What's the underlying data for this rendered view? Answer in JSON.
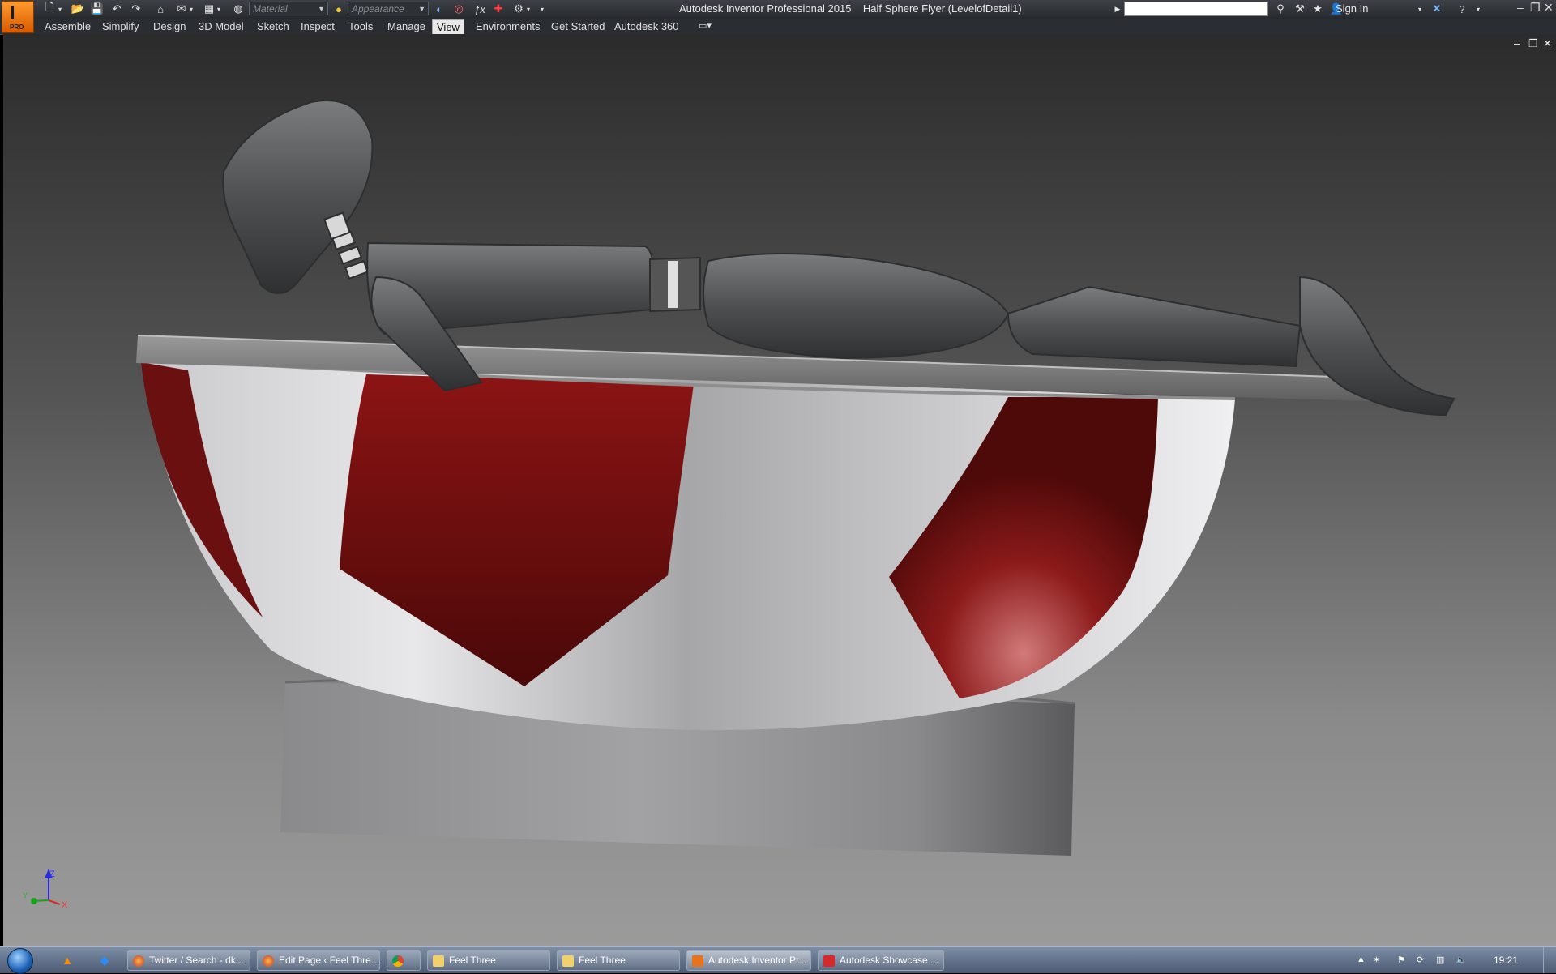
{
  "app": {
    "title": "Autodesk Inventor Professional 2015",
    "document": "Half Sphere Flyer (LevelofDetail1)",
    "logo_letter": "I",
    "logo_badge": "PRO"
  },
  "quick_access": {
    "material_placeholder": "Material",
    "appearance_placeholder": "Appearance"
  },
  "header_right": {
    "sign_in": "Sign In"
  },
  "menu": [
    "Assemble",
    "Simplify",
    "Design",
    "3D Model",
    "Sketch",
    "Inspect",
    "Tools",
    "Manage",
    "View",
    "Environments",
    "Get Started",
    "Autodesk 360"
  ],
  "active_menu": "View",
  "viewport": {
    "axis_labels": {
      "x": "X",
      "y": "Y",
      "z": "Z"
    },
    "model": "half-sphere flyer with reclining mannequin on a cylindrical base",
    "colors": {
      "shell": "#c8c8c8",
      "panel": "#7a1212",
      "base": "#7e7e80",
      "mannequin": "#5a5c5e"
    }
  },
  "taskbar": {
    "items": [
      {
        "label": "Twitter / Search - dk...",
        "icon": "firefox-icon"
      },
      {
        "label": "Edit Page ‹ Feel Thre...",
        "icon": "firefox-icon"
      },
      {
        "label": "",
        "icon": "chrome-icon"
      },
      {
        "label": "Feel Three",
        "icon": "folder-icon"
      },
      {
        "label": "Feel Three",
        "icon": "folder-icon"
      },
      {
        "label": "Autodesk Inventor Pr...",
        "icon": "inventor-icon",
        "active": true
      },
      {
        "label": "Autodesk Showcase ...",
        "icon": "showcase-icon"
      }
    ],
    "clock": "19:21"
  }
}
